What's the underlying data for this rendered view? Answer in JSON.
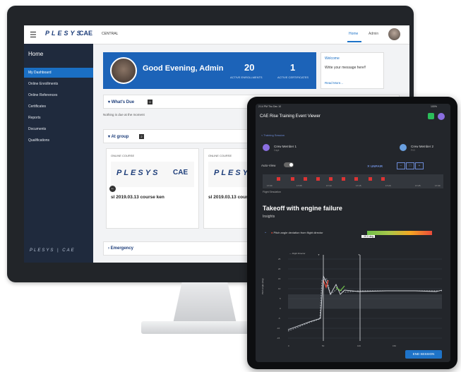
{
  "desktop": {
    "topbar": {
      "menu_icon": "hamburger-icon",
      "brand_left": "PLESYS",
      "brand_right": "CAE",
      "context": "CENTRAL",
      "nav": [
        "Home",
        "Admin"
      ]
    },
    "sidebar": {
      "title": "Home",
      "items": [
        "My Dashboard",
        "Online Enrollments",
        "Online References",
        "Certificates",
        "Reports",
        "Documents",
        "Qualifications"
      ],
      "active_index": 0,
      "footer_brand": "PLESYS | CAE"
    },
    "banner": {
      "greeting": "Good Evening, Admin",
      "stats": [
        {
          "value": "20",
          "label": "ACTIVE ENROLLMENTS"
        },
        {
          "value": "1",
          "label": "ACTIVE CERTIFICATES"
        }
      ]
    },
    "welcome": {
      "title": "Welcome",
      "message": "Write your message here!!",
      "more": "Read More..."
    },
    "whats_due": {
      "title": "What's Due",
      "count": "0",
      "empty": "Nothing is due at the moment"
    },
    "at_group": {
      "title": "At group",
      "count": "2"
    },
    "cards": [
      {
        "type": "ONLINE COURSE",
        "logo_left": "PLESYS",
        "logo_right": "CAE",
        "name": "sl 2019.03.13 course ken"
      },
      {
        "type": "ONLINE COURSE",
        "logo_left": "PLESYS",
        "logo_right": "",
        "name": "sl 2019.03.13 course"
      }
    ],
    "emergency": {
      "title": "Emergency"
    }
  },
  "tablet": {
    "status_left": "2:14 PM Thu Dec 10",
    "status_right": "100%",
    "title": "CAE Rise Training Event Viewer",
    "back": "< Training Session",
    "crew": [
      {
        "name": "Crew Member 1",
        "role": "Capt"
      },
      {
        "name": "Crew Member 2",
        "role": "F/O"
      }
    ],
    "auto_view": "Auto-View",
    "unpair": "UNPAIR",
    "timeline_ticks": [
      "17:00",
      "17:05",
      "17:10",
      "17:15",
      "17:20",
      "17:25",
      "17:30"
    ],
    "timeline_label": "Flight Simulation",
    "heading": "Takeoff with engine failure",
    "insights": "Insights",
    "insight_item": "Pitch angle deviation from flight director",
    "deviation": "-10.0 deg",
    "end_session": "END SESSION",
    "chart": {
      "ylabel": "Pitch angle (deg)",
      "yticks": [
        "25",
        "20",
        "15",
        "10",
        "5",
        "0",
        "-5",
        "-10",
        "-15"
      ],
      "xticks": [
        "0",
        "50",
        "100",
        "150"
      ],
      "legend": [
        "Flight Director",
        "Pitch angle"
      ]
    },
    "colors": {
      "accent": "#1e73c8",
      "bg": "#23262b",
      "good": "#6fbf4a",
      "bad": "#e94a3a"
    }
  }
}
